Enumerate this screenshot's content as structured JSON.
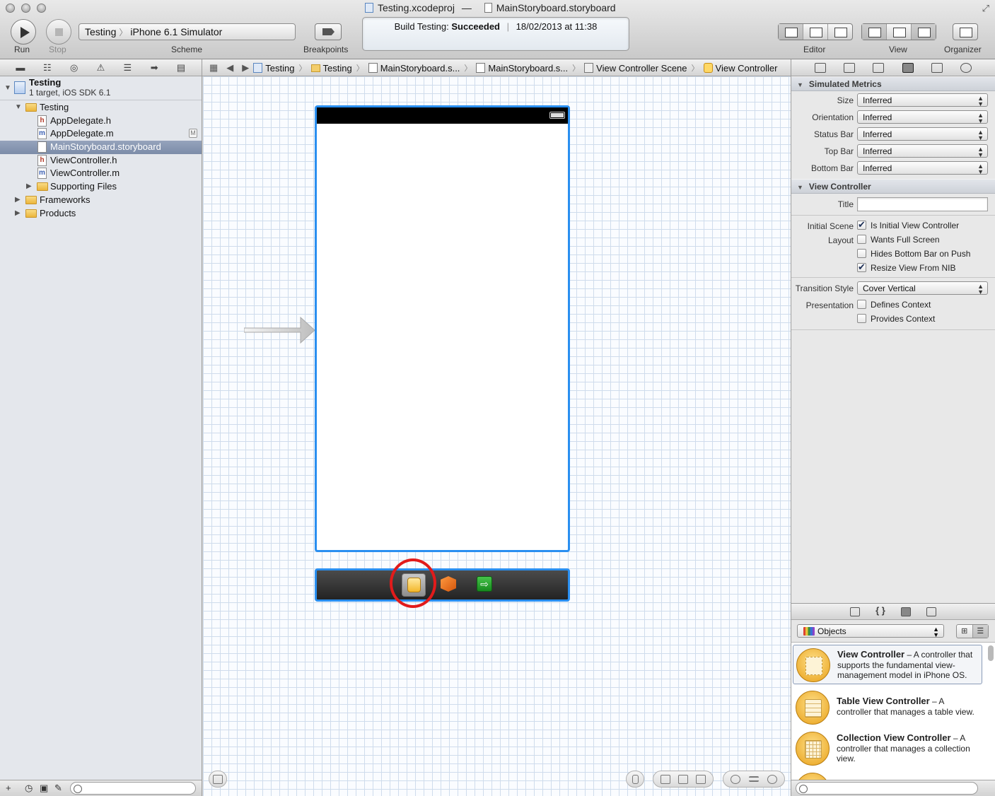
{
  "window": {
    "project_file": "Testing.xcodeproj",
    "separator": "—",
    "document": "MainStoryboard.storyboard"
  },
  "toolbar": {
    "run_label": "Run",
    "stop_label": "Stop",
    "scheme_target": "Testing",
    "scheme_destination": "iPhone 6.1 Simulator",
    "scheme_label": "Scheme",
    "breakpoints_label": "Breakpoints",
    "editor_label": "Editor",
    "view_label": "View",
    "organizer_label": "Organizer"
  },
  "activity": {
    "prefix": "Build Testing:",
    "status": "Succeeded",
    "timestamp": "18/02/2013 at 11:38"
  },
  "jump_bar": {
    "crumbs": [
      "Testing",
      "Testing",
      "MainStoryboard.s...",
      "MainStoryboard.s...",
      "View Controller Scene",
      "View Controller"
    ]
  },
  "navigator": {
    "project_name": "Testing",
    "project_subtitle": "1 target, iOS SDK 6.1",
    "items": [
      {
        "label": "Testing",
        "kind": "group"
      },
      {
        "label": "AppDelegate.h",
        "kind": "h"
      },
      {
        "label": "AppDelegate.m",
        "kind": "m",
        "badge": "M"
      },
      {
        "label": "MainStoryboard.storyboard",
        "kind": "storyboard",
        "selected": true
      },
      {
        "label": "ViewController.h",
        "kind": "h"
      },
      {
        "label": "ViewController.m",
        "kind": "m"
      },
      {
        "label": "Supporting Files",
        "kind": "group"
      },
      {
        "label": "Frameworks",
        "kind": "group"
      },
      {
        "label": "Products",
        "kind": "group"
      }
    ]
  },
  "inspector": {
    "simulated_metrics": {
      "title": "Simulated Metrics",
      "rows": [
        {
          "label": "Size",
          "value": "Inferred"
        },
        {
          "label": "Orientation",
          "value": "Inferred"
        },
        {
          "label": "Status Bar",
          "value": "Inferred"
        },
        {
          "label": "Top Bar",
          "value": "Inferred"
        },
        {
          "label": "Bottom Bar",
          "value": "Inferred"
        }
      ]
    },
    "view_controller": {
      "title": "View Controller",
      "title_label": "Title",
      "title_value": "",
      "initial_scene_label": "Initial Scene",
      "is_initial": "Is Initial View Controller",
      "layout_label": "Layout",
      "wants_full_screen": "Wants Full Screen",
      "hides_bottom_bar": "Hides Bottom Bar on Push",
      "resize_view": "Resize View From NIB",
      "transition_label": "Transition Style",
      "transition_value": "Cover Vertical",
      "presentation_label": "Presentation",
      "defines_context": "Defines Context",
      "provides_context": "Provides Context"
    }
  },
  "library": {
    "selector": "Objects",
    "items": [
      {
        "name": "View Controller",
        "desc": " – A controller that supports the fundamental view-management model in iPhone OS."
      },
      {
        "name": "Table View Controller",
        "desc": " – A controller that manages a table view."
      },
      {
        "name": "Collection View Controller",
        "desc": " – A controller that manages a collection view."
      }
    ]
  },
  "colors": {
    "selection_blue": "#2a8ff0",
    "highlight_red": "#e21b1b"
  },
  "icons": [
    "run-icon",
    "stop-icon",
    "breakpoint-icon",
    "project-icon",
    "folder-icon",
    "header-file-icon",
    "implementation-file-icon",
    "storyboard-file-icon",
    "battery-icon",
    "view-controller-icon",
    "first-responder-icon",
    "exit-icon",
    "objects-library-icon"
  ]
}
